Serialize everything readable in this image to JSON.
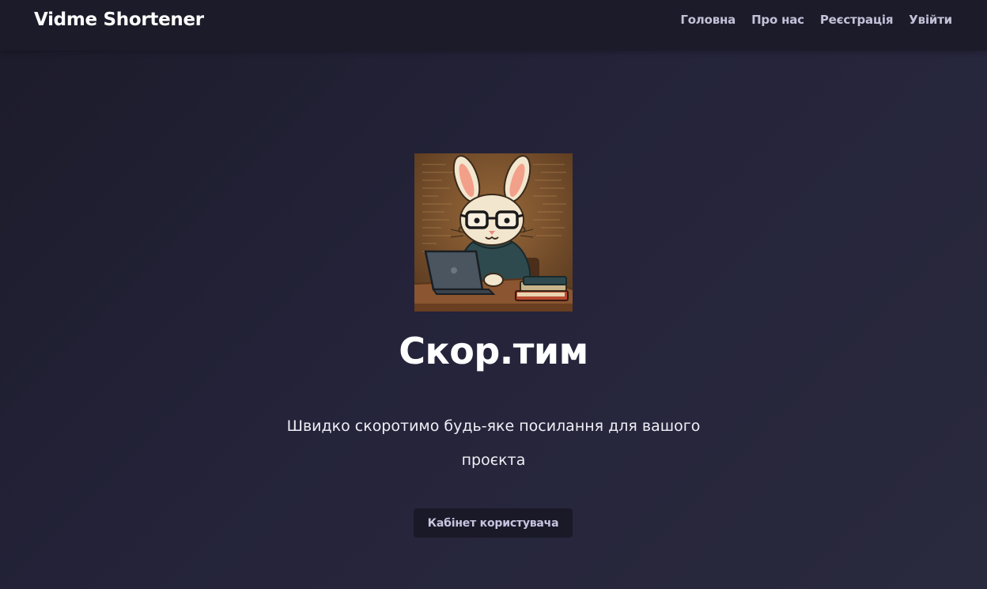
{
  "navbar": {
    "brand": "Vidme Shortener",
    "links": [
      {
        "label": "Головна"
      },
      {
        "label": "Про нас"
      },
      {
        "label": "Реєстрація"
      },
      {
        "label": "Увійти"
      }
    ]
  },
  "hero": {
    "image_alt": "bunny-coder-illustration",
    "title": "Скор.тим",
    "subtitle": "Швидко скоротимо будь-яке посилання для вашого проєкта",
    "cta_label": "Кабінет користувача"
  },
  "colors": {
    "background": "#24233a",
    "navbar": "#1c1b29",
    "nav_link": "#c3c0d8",
    "button_bg": "#1a1928",
    "button_text": "#c7c3e0"
  }
}
